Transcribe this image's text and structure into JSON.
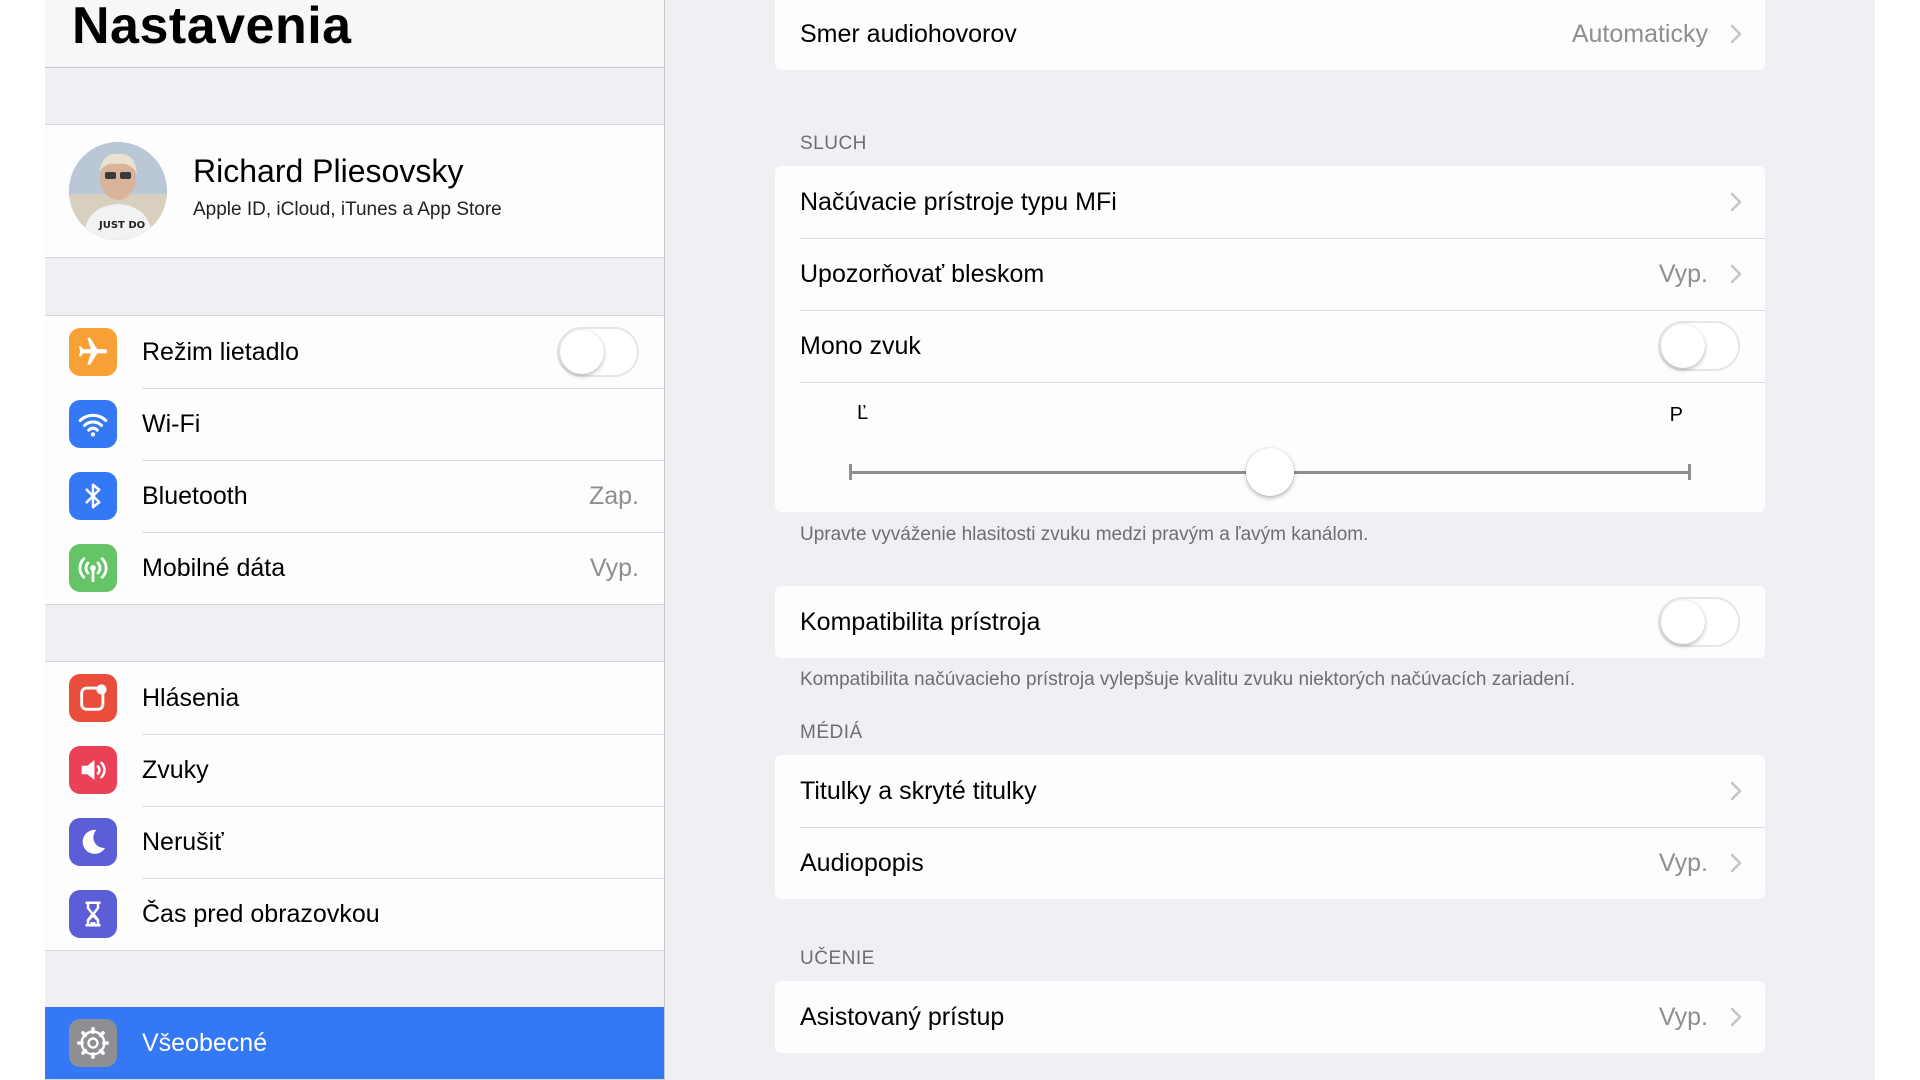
{
  "sidebar": {
    "title": "Nastavenia",
    "profile": {
      "name": "Richard Pliesovsky",
      "subtitle": "Apple ID, iCloud, iTunes a App Store",
      "shirt_text": "JUST DO"
    },
    "group1": [
      {
        "label": "Režim lietadlo",
        "icon": "airplane-icon",
        "color": "#f7a035"
      },
      {
        "label": "Wi-Fi",
        "icon": "wifi-icon",
        "color": "#3478f6"
      },
      {
        "label": "Bluetooth",
        "value": "Zap.",
        "icon": "bluetooth-icon",
        "color": "#3478f6"
      },
      {
        "label": "Mobilné dáta",
        "value": "Vyp.",
        "icon": "antenna-icon",
        "color": "#65c466"
      }
    ],
    "group2": [
      {
        "label": "Hlásenia",
        "icon": "notifications-icon",
        "color": "#eb4d3d"
      },
      {
        "label": "Zvuky",
        "icon": "speaker-icon",
        "color": "#eb4156"
      },
      {
        "label": "Nerušiť",
        "icon": "moon-icon",
        "color": "#5b5ed6"
      },
      {
        "label": "Čas pred obrazovkou",
        "icon": "hourglass-icon",
        "color": "#5b5ed6"
      }
    ],
    "group3": [
      {
        "label": "Všeobecné",
        "icon": "gear-icon",
        "color": "#8e8e93",
        "selected": true
      }
    ],
    "airplane_mode_on": false,
    "selection_color": "#3478f6"
  },
  "detail": {
    "top_row": {
      "label": "Smer audiohovorov",
      "value": "Automaticky"
    },
    "hearing": {
      "header": "SLUCH",
      "rows": [
        {
          "label": "Načúvacie prístroje typu MFi"
        },
        {
          "label": "Upozorňovať bleskom",
          "value": "Vyp."
        },
        {
          "label": "Mono zvuk"
        }
      ],
      "mono_on": false,
      "balance": {
        "left_label": "Ľ",
        "right_label": "P",
        "position": 0.5
      },
      "footnote": "Upravte vyváženie hlasitosti zvuku medzi pravým a ľavým kanálom."
    },
    "compatibility": {
      "label": "Kompatibilita prístroja",
      "on": false,
      "footnote": "Kompatibilita načúvacieho prístroja vylepšuje kvalitu zvuku niektorých načúvacích zariadení."
    },
    "media": {
      "header": "MÉDIÁ",
      "rows": [
        {
          "label": "Titulky a skryté titulky"
        },
        {
          "label": "Audiopopis",
          "value": "Vyp."
        }
      ]
    },
    "learning": {
      "header": "UČENIE",
      "rows": [
        {
          "label": "Asistovaný prístup",
          "value": "Vyp."
        }
      ]
    }
  }
}
